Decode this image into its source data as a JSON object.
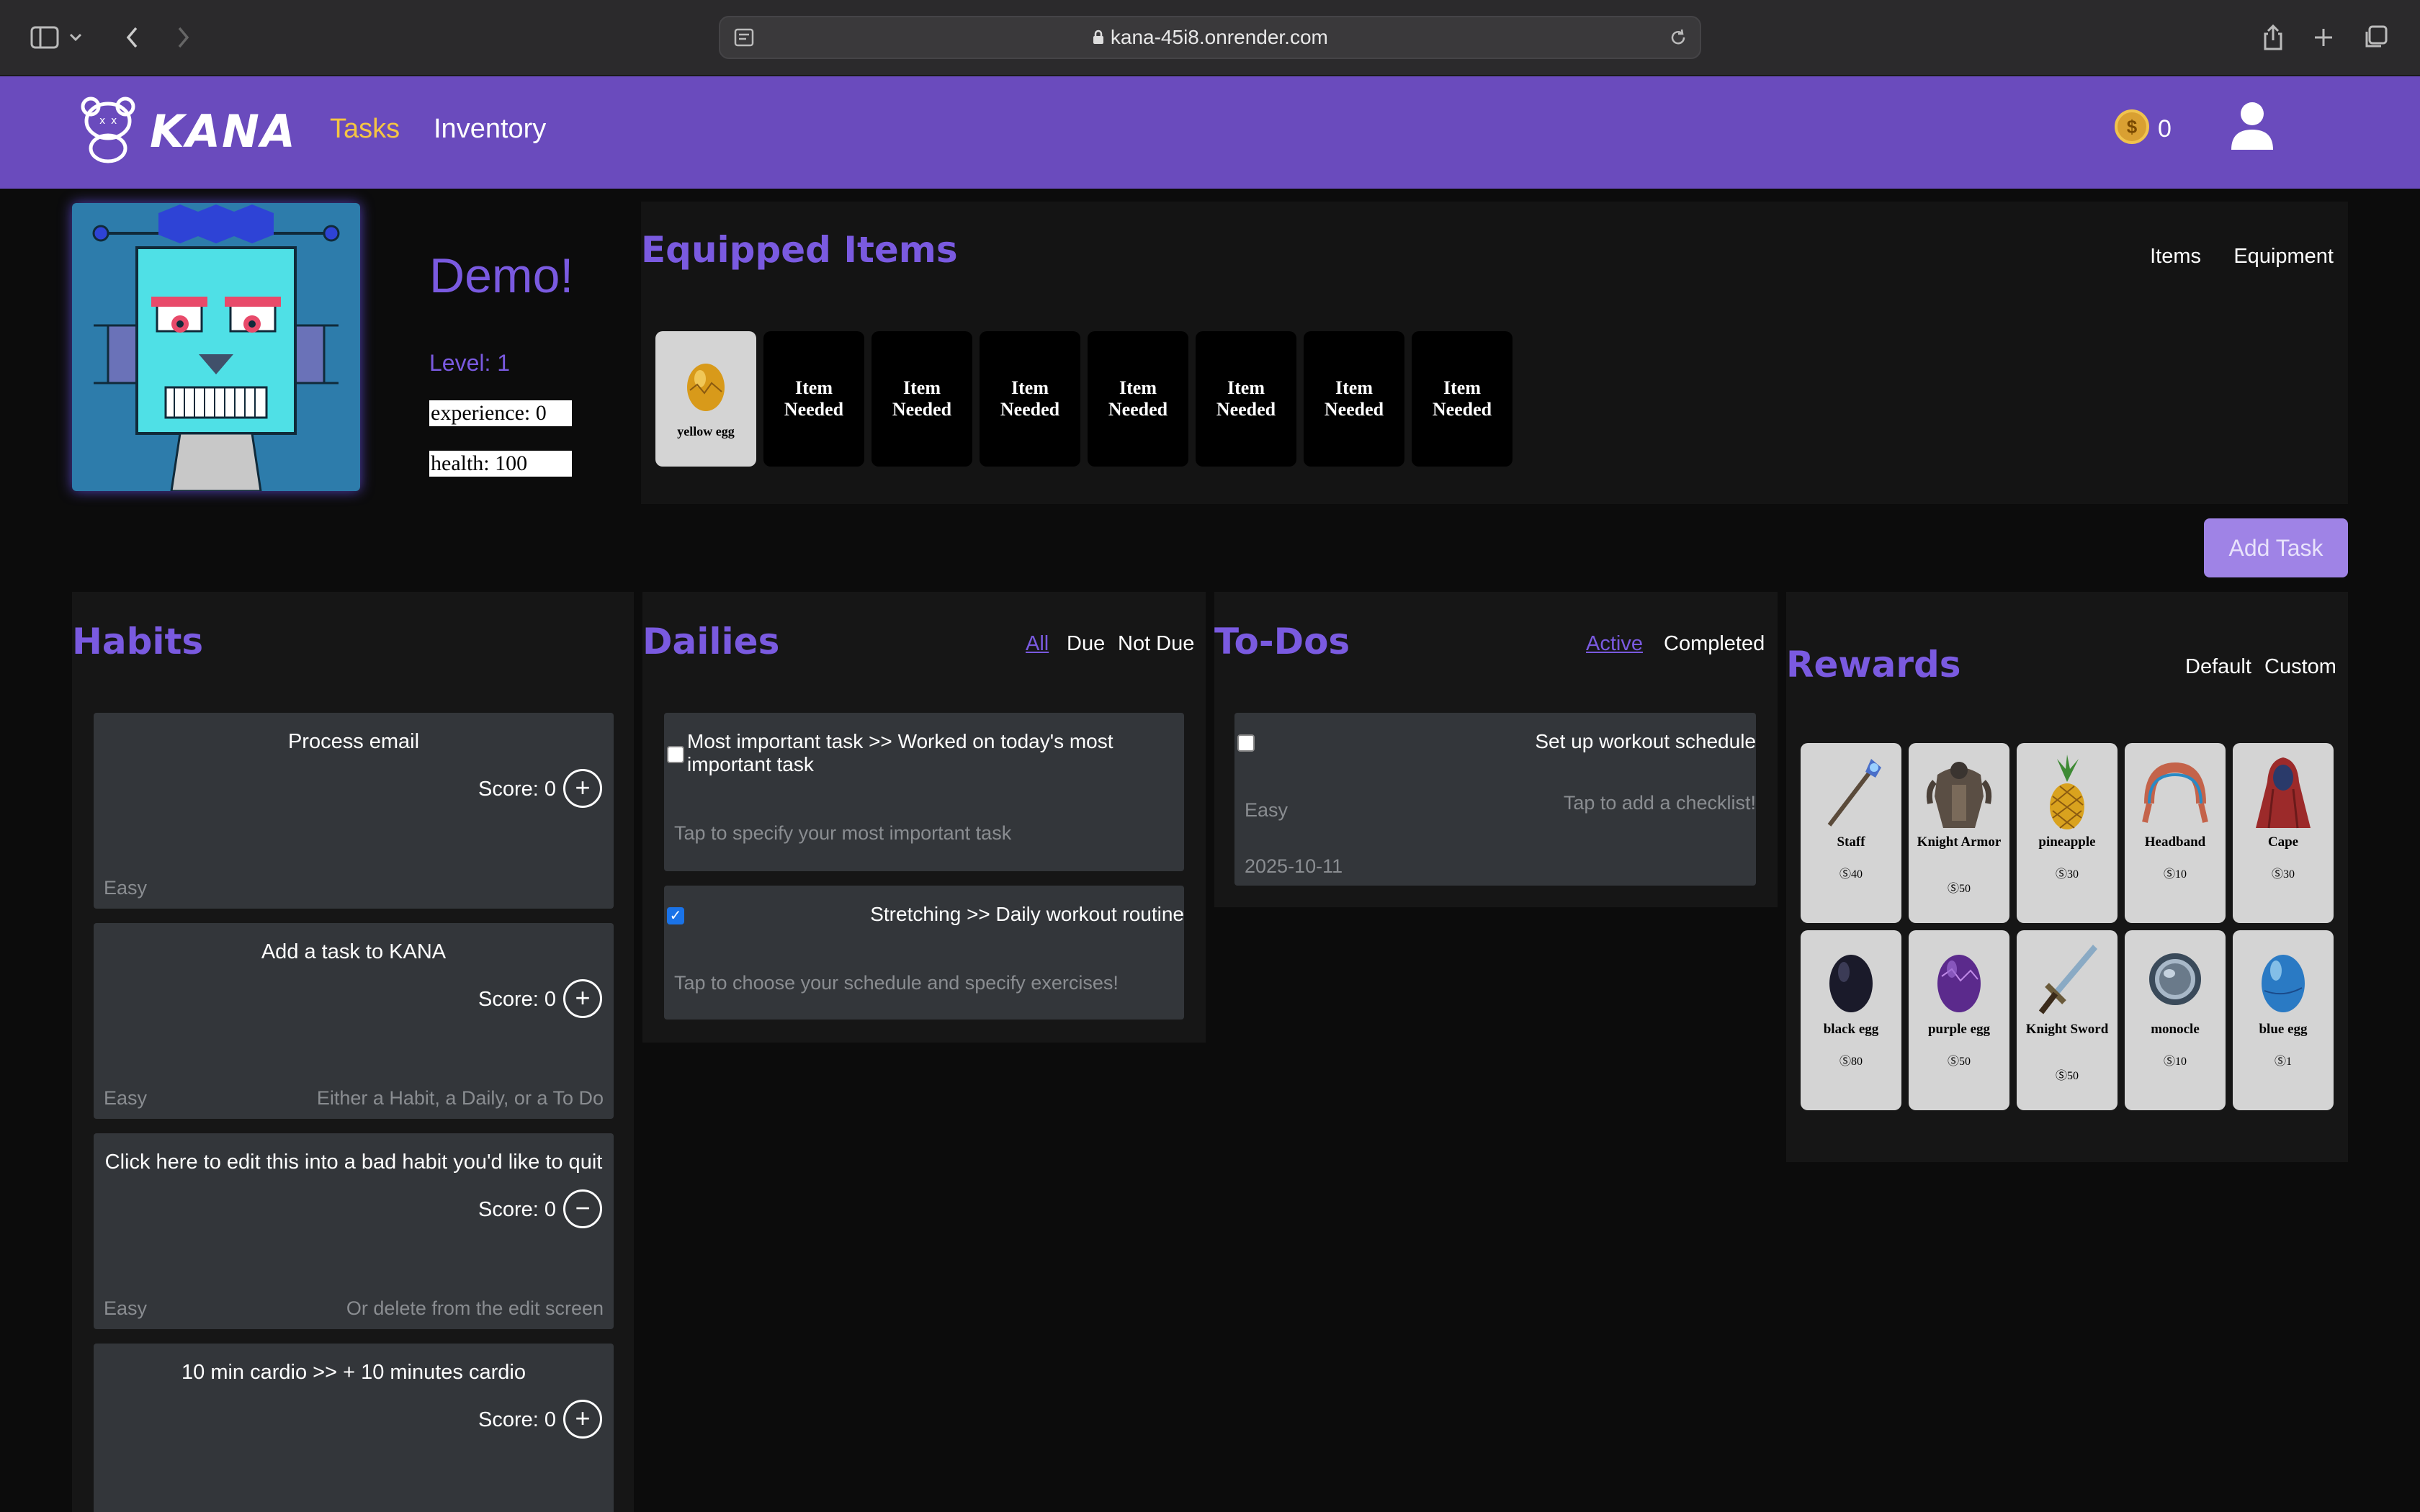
{
  "browser": {
    "url": "kana-45i8.onrender.com"
  },
  "header": {
    "logo_text": "KANA",
    "nav": [
      {
        "label": "Tasks",
        "active": true
      },
      {
        "label": "Inventory",
        "active": false
      }
    ],
    "coin_icon": "dollar-coin-icon",
    "coins": "0",
    "account_icon": "user-icon"
  },
  "profile": {
    "name": "Demo!",
    "level": "Level: 1",
    "experience": "experience: 0",
    "health": "health: 100"
  },
  "equipped": {
    "title": "Equipped Items",
    "tabs": [
      "Items",
      "Equipment"
    ],
    "slots": [
      {
        "label": "yellow egg",
        "filled": true
      },
      {
        "label": "Item Needed",
        "filled": false
      },
      {
        "label": "Item Needed",
        "filled": false
      },
      {
        "label": "Item Needed",
        "filled": false
      },
      {
        "label": "Item Needed",
        "filled": false
      },
      {
        "label": "Item Needed",
        "filled": false
      },
      {
        "label": "Item Needed",
        "filled": false
      },
      {
        "label": "Item Needed",
        "filled": false
      }
    ]
  },
  "add_task_label": "Add Task",
  "habits": {
    "title": "Habits",
    "items": [
      {
        "title": "Process email",
        "score": "Score: 0",
        "button": "+",
        "difficulty": "Easy",
        "note": ""
      },
      {
        "title": "Add a task to KANA",
        "score": "Score: 0",
        "button": "+",
        "difficulty": "Easy",
        "note": "Either a Habit, a Daily, or a To Do"
      },
      {
        "title": "Click here to edit this into a bad habit you'd like to quit",
        "score": "Score: 0",
        "button": "−",
        "difficulty": "Easy",
        "note": "Or delete from the edit screen"
      },
      {
        "title": "10 min cardio >> + 10 minutes cardio",
        "score": "Score: 0",
        "button": "+",
        "difficulty": "",
        "note": ""
      }
    ]
  },
  "dailies": {
    "title": "Dailies",
    "filters": [
      "All",
      "Due",
      "Not Due"
    ],
    "items": [
      {
        "title": "Most important task >> Worked on today's most important task",
        "note": "Tap to specify your most important task",
        "checked": false
      },
      {
        "title": "Stretching >> Daily workout routine",
        "note": "Tap to choose your schedule and specify exercises!",
        "checked": true
      }
    ]
  },
  "todos": {
    "title": "To-Dos",
    "filters": [
      "Active",
      "Completed"
    ],
    "items": [
      {
        "title": "Set up workout schedule",
        "note": "Tap to add a checklist!",
        "difficulty": "Easy",
        "date": "2025-10-11",
        "checked": false
      }
    ]
  },
  "rewards": {
    "title": "Rewards",
    "filters": [
      "Default",
      "Custom"
    ],
    "items": [
      {
        "name": "Staff",
        "price": "40",
        "icon": "staff-icon",
        "color": "#4a6fc9"
      },
      {
        "name": "Knight Armor",
        "price": "50",
        "icon": "armor-icon",
        "color": "#6b5a4a"
      },
      {
        "name": "pineapple",
        "price": "30",
        "icon": "pineapple-icon",
        "color": "#d9a21e"
      },
      {
        "name": "Headband",
        "price": "10",
        "icon": "headband-icon",
        "color": "#c4634a"
      },
      {
        "name": "Cape",
        "price": "30",
        "icon": "cape-icon",
        "color": "#9c2a2a"
      },
      {
        "name": "black egg",
        "price": "80",
        "icon": "black-egg-icon",
        "color": "#1a1a2a"
      },
      {
        "name": "purple egg",
        "price": "50",
        "icon": "purple-egg-icon",
        "color": "#5b2a8c"
      },
      {
        "name": "Knight Sword",
        "price": "50",
        "icon": "sword-icon",
        "color": "#5a7a9a"
      },
      {
        "name": "monocle",
        "price": "10",
        "icon": "monocle-icon",
        "color": "#6a7a8a"
      },
      {
        "name": "blue egg",
        "price": "1",
        "icon": "blue-egg-icon",
        "color": "#2a7ac4"
      }
    ]
  },
  "colors": {
    "brand_purple": "#6a4bbd",
    "accent_purple": "#7a5ae0",
    "active_nav": "#f5c542"
  }
}
